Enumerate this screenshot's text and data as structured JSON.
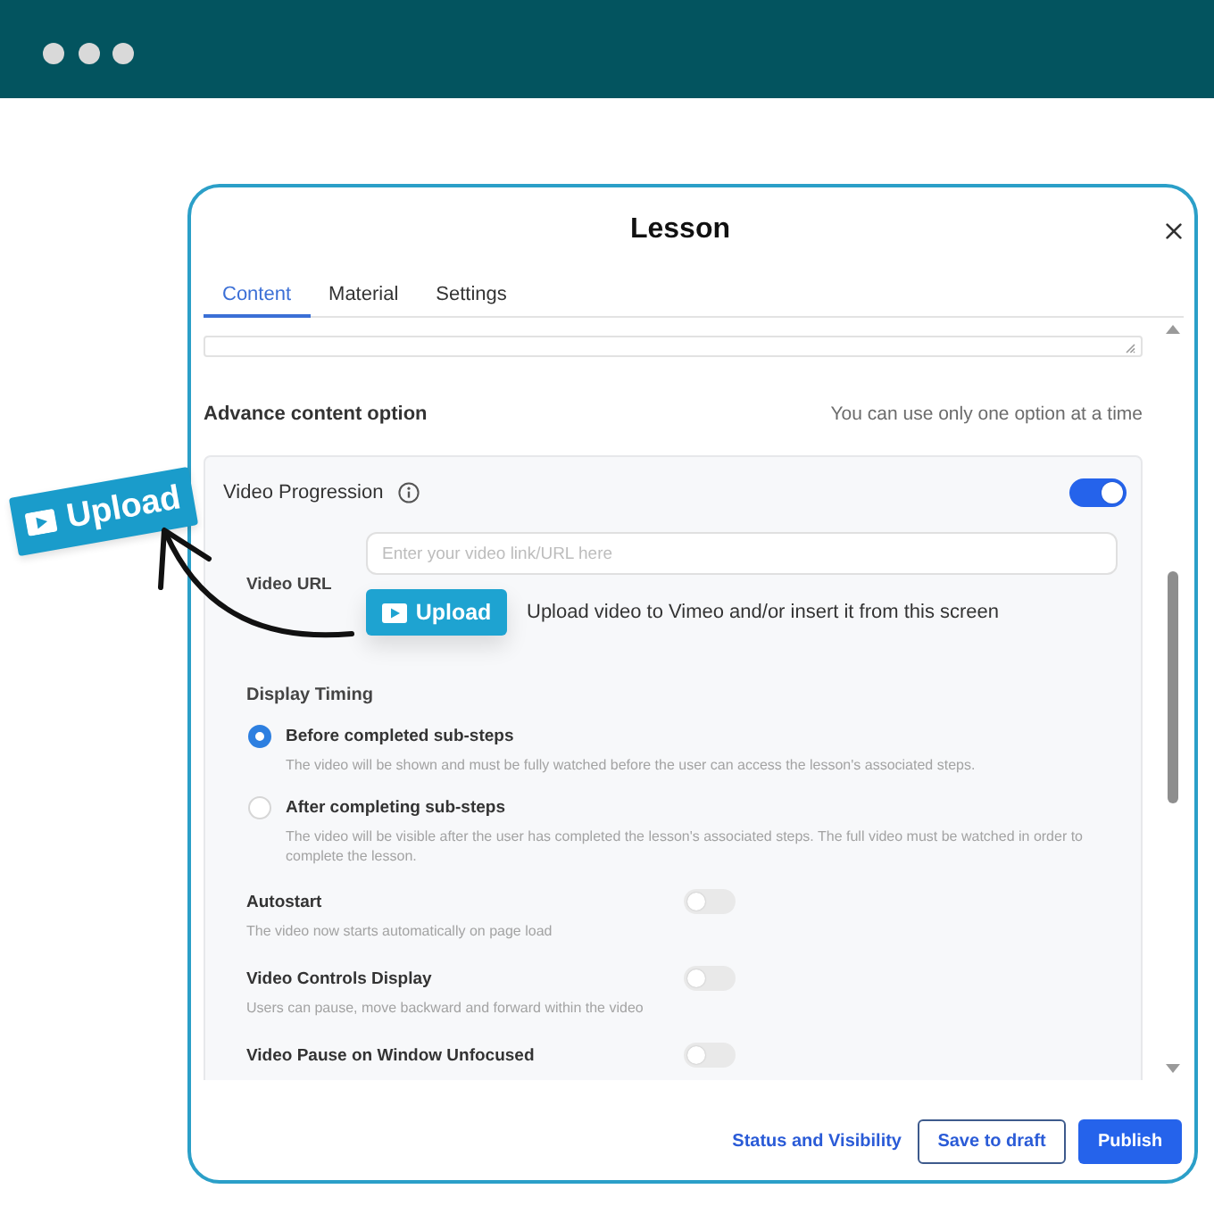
{
  "dialog": {
    "title": "Lesson"
  },
  "tabs": [
    {
      "label": "Content",
      "selected": true
    },
    {
      "label": "Material",
      "selected": false
    },
    {
      "label": "Settings",
      "selected": false
    }
  ],
  "advanced": {
    "heading": "Advance content option",
    "note": "You can use only one option at a time"
  },
  "video_progression": {
    "label": "Video Progression",
    "on": true,
    "video_url": {
      "label": "Video URL",
      "placeholder": "Enter your video link/URL here"
    },
    "upload": {
      "button": "Upload",
      "hint": "Upload video to Vimeo and/or insert it from this screen"
    },
    "display_timing": {
      "label": "Display Timing",
      "options": [
        {
          "title": "Before completed sub-steps",
          "description": "The video will be shown and must be fully watched before the user can access the lesson's associated steps.",
          "selected": true
        },
        {
          "title": "After completing sub-steps",
          "description": "The video will be visible after the user has completed the lesson's associated steps. The full video must be watched in order to complete the lesson.",
          "selected": false
        }
      ]
    },
    "settings": [
      {
        "title": "Autostart",
        "description": "The video now starts automatically on page load",
        "on": false
      },
      {
        "title": "Video Controls Display",
        "description": "Users can pause, move backward and forward within the video",
        "on": false
      },
      {
        "title": "Video Pause on Window Unfocused",
        "on": false
      }
    ]
  },
  "footer": {
    "link": "Status and Visibility",
    "buttons": [
      {
        "label": "Save to draft",
        "kind": "outline"
      },
      {
        "label": "Publish",
        "kind": "primary"
      }
    ]
  },
  "callout": {
    "label": "Upload"
  }
}
